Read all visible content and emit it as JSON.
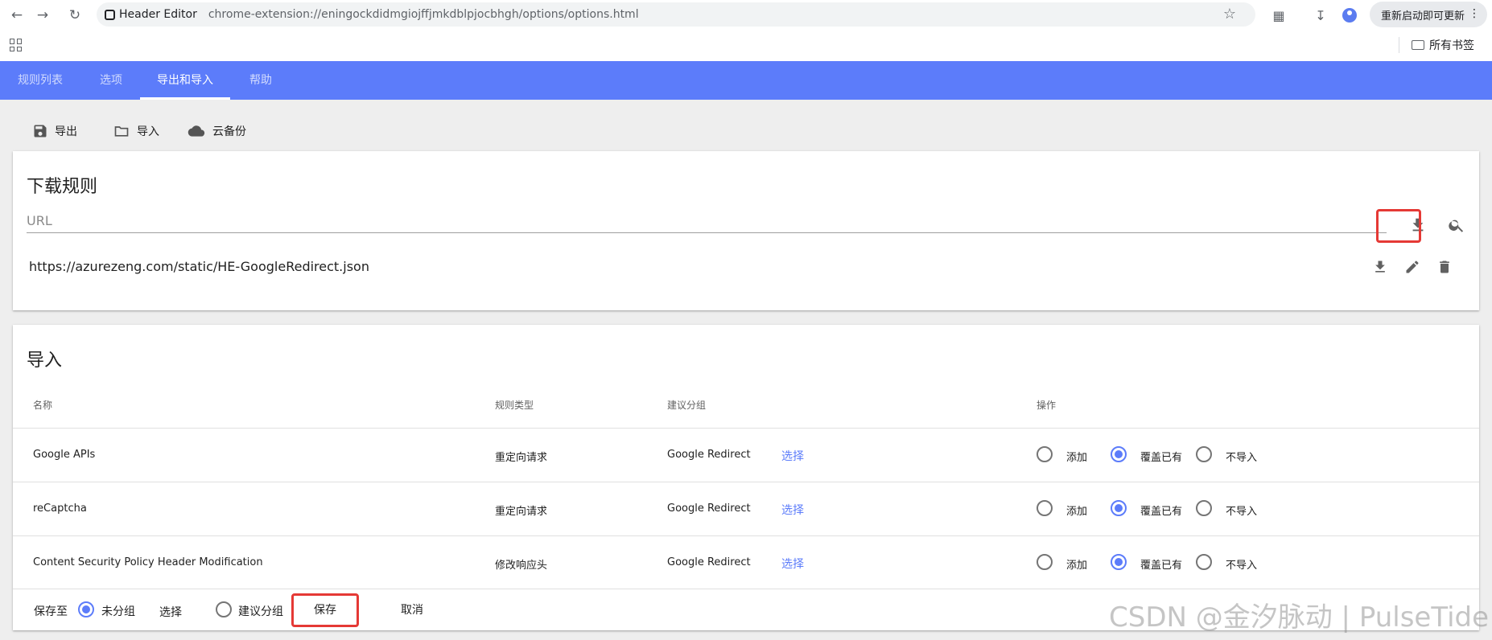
{
  "browser": {
    "extension_name": "Header Editor",
    "url": "chrome-extension://eningockdidmgiojffjmkdblpjocbhgh/options/options.html",
    "restart_label": "重新启动即可更新",
    "all_bookmarks": "所有书签"
  },
  "tabs": [
    {
      "label": "规则列表"
    },
    {
      "label": "选项"
    },
    {
      "label": "导出和导入"
    },
    {
      "label": "帮助"
    }
  ],
  "toolbar": {
    "export_label": "导出",
    "import_label": "导入",
    "cloud_label": "云备份"
  },
  "download": {
    "title": "下载规则",
    "url_placeholder": "URL",
    "rule_url": "https://azurezeng.com/static/HE-GoogleRedirect.json"
  },
  "import": {
    "title": "导入",
    "headers": {
      "name": "名称",
      "type": "规则类型",
      "group": "建议分组",
      "action": "操作"
    },
    "select_label": "选择",
    "options": {
      "add": "添加",
      "override": "覆盖已有",
      "skip": "不导入"
    },
    "rows": [
      {
        "name": "Google APIs",
        "type": "重定向请求",
        "group": "Google Redirect",
        "selected": "override"
      },
      {
        "name": "reCaptcha",
        "type": "重定向请求",
        "group": "Google Redirect",
        "selected": "override"
      },
      {
        "name": "Content Security Policy Header Modification",
        "type": "修改响应头",
        "group": "Google Redirect",
        "selected": "override"
      }
    ],
    "footer": {
      "save_to": "保存至",
      "ungrouped": "未分组",
      "select": "选择",
      "suggested_group": "建议分组",
      "save": "保存",
      "cancel": "取消"
    }
  },
  "watermark": "CSDN @金汐脉动 | PulseTide",
  "colors": {
    "accent": "#5c7cfa",
    "highlight": "#e53935"
  }
}
